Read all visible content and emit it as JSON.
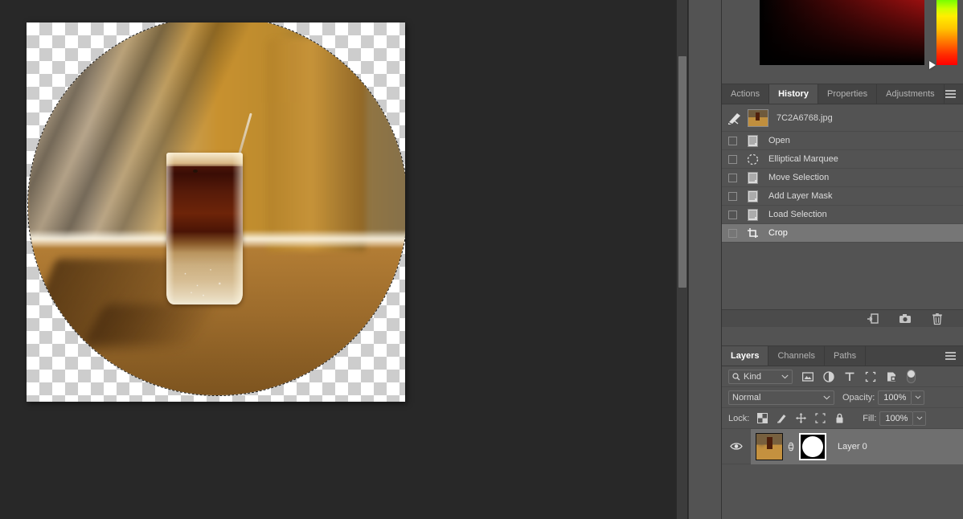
{
  "document": {
    "canvas": {
      "checker_light": "#ffffff",
      "checker_dark": "#cdcdcd",
      "selection_shape": "ellipse",
      "selection_state": "active-marching-ants"
    },
    "photo_description": "iced coffee drink in a tall glass on a sunlit wooden table with shadow patterns on the wall",
    "background_color": "#282828"
  },
  "color_picker": {
    "name": "color-picker",
    "field_gradient_from": "#000000",
    "field_gradient_to": "#c81414",
    "hue_strip_colors": [
      "#00ff00",
      "#ccff00",
      "#ffee00",
      "#ffc400",
      "#ff7a00",
      "#ff0000"
    ],
    "marker_position": "bottom"
  },
  "history_panel": {
    "tabs": [
      {
        "label": "Actions",
        "active": false
      },
      {
        "label": "History",
        "active": true
      },
      {
        "label": "Properties",
        "active": false
      },
      {
        "label": "Adjustments",
        "active": false
      }
    ],
    "snapshot": {
      "name": "7C2A6768.jpg"
    },
    "states": [
      {
        "label": "Open",
        "icon": "document-icon",
        "selected": false
      },
      {
        "label": "Elliptical Marquee",
        "icon": "elliptical-marquee-icon",
        "selected": false
      },
      {
        "label": "Move Selection",
        "icon": "document-icon",
        "selected": false
      },
      {
        "label": "Add Layer Mask",
        "icon": "document-icon",
        "selected": false
      },
      {
        "label": "Load Selection",
        "icon": "document-icon",
        "selected": false
      },
      {
        "label": "Crop",
        "icon": "crop-icon",
        "selected": true
      }
    ],
    "footer_buttons": [
      {
        "name": "create-document-from-state-button",
        "icon": "new-document-icon"
      },
      {
        "name": "create-snapshot-button",
        "icon": "camera-icon"
      },
      {
        "name": "delete-state-button",
        "icon": "trash-icon"
      }
    ]
  },
  "layers_panel": {
    "tabs": [
      {
        "label": "Layers",
        "active": true
      },
      {
        "label": "Channels",
        "active": false
      },
      {
        "label": "Paths",
        "active": false
      }
    ],
    "filter": {
      "kind_label": "Kind",
      "icons": [
        "pixel-layer-filter-icon",
        "adjustment-layer-filter-icon",
        "type-layer-filter-icon",
        "shape-layer-filter-icon",
        "smart-object-filter-icon"
      ],
      "toggle": "filter-enable-toggle"
    },
    "blend_mode": "Normal",
    "opacity_label": "Opacity:",
    "opacity_value": "100%",
    "lock_label": "Lock:",
    "lock_icons": [
      "lock-transparent-pixels-icon",
      "lock-image-pixels-icon",
      "lock-position-icon",
      "lock-artboard-nesting-icon",
      "lock-all-icon"
    ],
    "fill_label": "Fill:",
    "fill_value": "100%",
    "layers": [
      {
        "name": "Layer 0",
        "visible": true,
        "has_mask": true,
        "mask_shape": "circle",
        "linked": true,
        "selected": true
      }
    ]
  }
}
